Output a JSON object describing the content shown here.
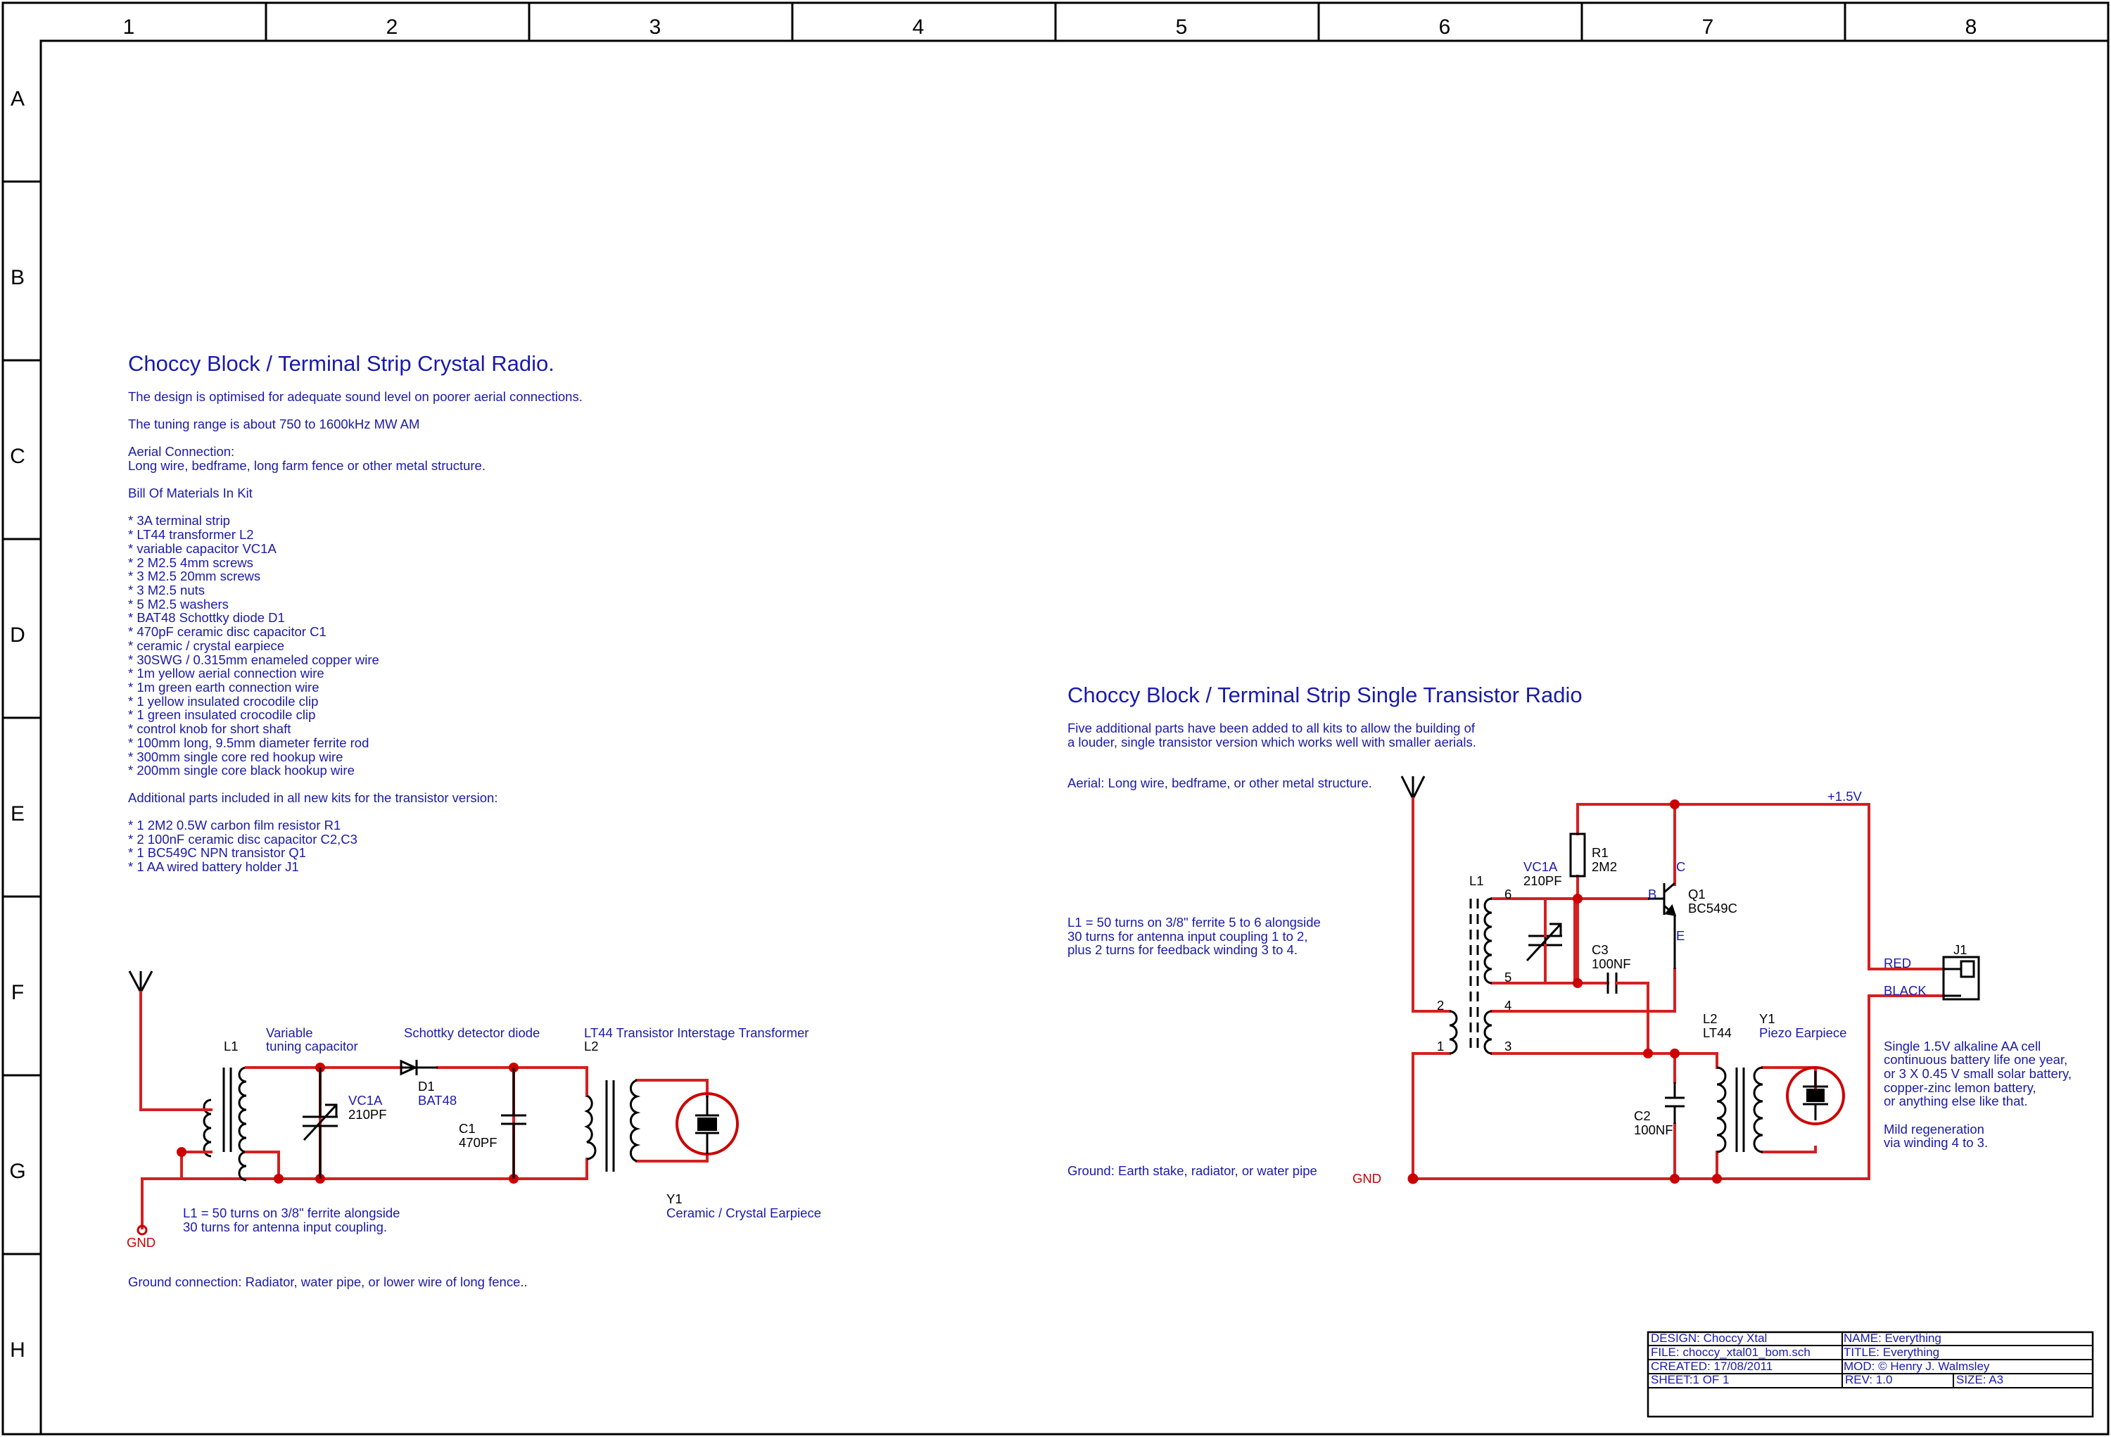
{
  "frame": {
    "columns": [
      "1",
      "2",
      "3",
      "4",
      "5",
      "6",
      "7",
      "8"
    ],
    "rows": [
      "A",
      "B",
      "C",
      "D",
      "E",
      "F",
      "G",
      "H"
    ]
  },
  "crystal": {
    "title": "Choccy Block / Terminal Strip Crystal Radio.",
    "notes": [
      "The design is optimised for adequate sound level on poorer aerial connections.",
      "The tuning range is about 750 to 1600kHz MW AM",
      "Aerial Connection:",
      "Long wire, bedframe, long farm fence or other metal structure.",
      "Bill Of Materials In Kit"
    ],
    "bom": [
      "* 3A terminal strip",
      "* LT44 transformer L2",
      "* variable capacitor VC1A",
      "* 2 M2.5 4mm screws",
      "* 3 M2.5 20mm screws",
      "* 3 M2.5 nuts",
      "* 5 M2.5 washers",
      "* BAT48 Schottky diode D1",
      "* 470pF ceramic disc capacitor C1",
      "* ceramic / crystal earpiece",
      "* 30SWG / 0.315mm enameled copper wire",
      "* 1m yellow aerial connection wire",
      "* 1m green earth connection wire",
      "* 1 yellow insulated crocodile clip",
      "* 1 green insulated crocodile clip",
      "* control knob for short shaft",
      "* 100mm long, 9.5mm diameter ferrite rod",
      "* 300mm single core red hookup wire",
      "* 200mm single core black hookup wire"
    ],
    "additional_header": "Additional parts included in all new kits for the transistor version:",
    "additional": [
      "* 1 2M2 0.5W carbon film resistor R1",
      "* 2 100nF ceramic disc capacitor C2,C3",
      "* 1 BC549C NPN transistor Q1",
      "* 1 AA wired battery holder J1"
    ],
    "labels": {
      "l1": "L1",
      "vcap_1": "Variable",
      "vcap_2": "tuning capacitor",
      "vc1a": "VC1A",
      "vc1a_val": "210PF",
      "schottky": "Schottky detector diode",
      "d1": "D1",
      "bat48": "BAT48",
      "c1": "C1",
      "c1_val": "470PF",
      "lt44": "LT44 Transistor Interstage Transformer",
      "l2": "L2",
      "y1": "Y1",
      "earpiece": "Ceramic / Crystal Earpiece",
      "gnd": "GND",
      "l1_note_1": "L1 = 50 turns on 3/8\" ferrite alongside",
      "l1_note_2": "30 turns for antenna input coupling.",
      "ground": "Ground connection:  Radiator, water pipe, or lower wire of long fence.."
    }
  },
  "transistor": {
    "title": "Choccy Block / Terminal Strip Single Transistor Radio",
    "intro_1": "Five additional parts have been added to all kits to allow the building of",
    "intro_2": "a louder, single transistor version which works well with smaller aerials.",
    "aerial": "Aerial: Long wire, bedframe, or other metal structure.",
    "l1_note": [
      "L1 = 50 turns on 3/8\" ferrite 5 to 6 alongside",
      "30 turns for antenna input coupling 1 to 2,",
      "plus 2 turns for feedback winding 3 to 4."
    ],
    "ground": "Ground: Earth stake, radiator, or water pipe",
    "gnd": "GND",
    "supply": "+1.5V",
    "labels": {
      "l1": "L1",
      "vc1a": "VC1A",
      "vc1a_val": "210PF",
      "r1": "R1",
      "r1_val": "2M2",
      "c3": "C3",
      "c3_val": "100NF",
      "q1": "Q1",
      "q1_val": "BC549C",
      "pin_b": "B",
      "pin_c": "C",
      "pin_e": "E",
      "n6": "6",
      "n5": "5",
      "n4": "4",
      "n3": "3",
      "n2": "2",
      "n1": "1",
      "l2": "L2",
      "lt44": "LT44",
      "y1": "Y1",
      "piezo": "Piezo Earpiece",
      "c2": "C2",
      "c2_val": "100NF",
      "red": "RED",
      "black": "BLACK",
      "j1": "J1"
    },
    "battery_note": [
      "Single 1.5V alkaline AA cell",
      "continuous battery life one year,",
      "or 3 X 0.45 V small solar battery,",
      "copper-zinc lemon battery,",
      "or anything else like that."
    ],
    "regen_note": [
      "Mild regeneration",
      "via winding 4 to 3."
    ]
  },
  "titleblock": {
    "design": "DESIGN:  Choccy Xtal",
    "name": "NAME:   Everything",
    "file": "FILE: choccy_xtal01_bom.sch",
    "title": "TITLE:   Everything",
    "created": "CREATED:   17/08/2011",
    "mod": "MOD: © Henry J. Walmsley",
    "sheet": "SHEET:1    OF  1",
    "rev": "REV: 1.0",
    "size": "SIZE: A3"
  }
}
